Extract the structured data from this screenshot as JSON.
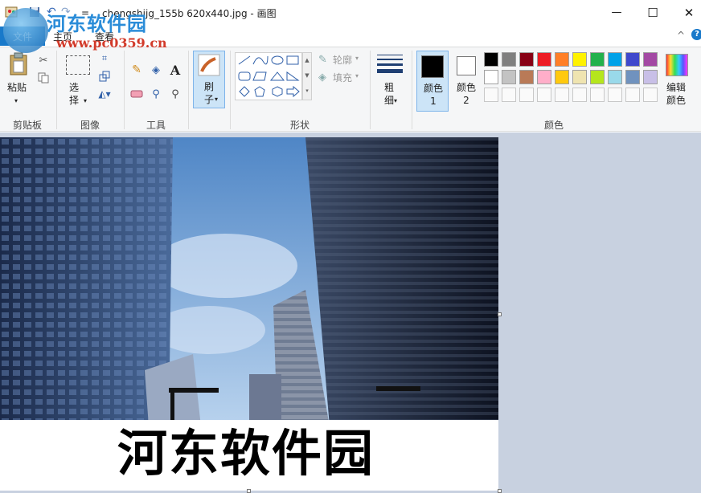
{
  "titlebar": {
    "filename": "chengshijg_155b 620x440.jpg",
    "separator": "-",
    "app_name": "画图",
    "qat_dropdown": "=",
    "minimize": "—",
    "maximize": "☐",
    "close": "✕"
  },
  "menu": {
    "file_tab": "文件",
    "home_tab": "主页",
    "view_tab": "查看",
    "help": "?",
    "collapse": "^"
  },
  "watermark": {
    "site_name": "河东软件园",
    "url": "www.pc0359.cn"
  },
  "ribbon": {
    "clipboard": {
      "paste_label": "粘贴",
      "group_label": "剪贴板"
    },
    "image": {
      "select_label": "选择",
      "group_label": "图像"
    },
    "tools": {
      "group_label": "工具"
    },
    "brushes": {
      "label": "刷子"
    },
    "shapes": {
      "outline_label": "轮廓",
      "fill_label": "填充",
      "group_label": "形状"
    },
    "size": {
      "label": "粗细"
    },
    "colors": {
      "color1_label": "颜色 1",
      "color2_label": "颜色 2",
      "edit_colors_label": "编辑颜色",
      "group_label": "颜色",
      "color1_value": "#000000",
      "color2_value": "#ffffff",
      "palette_row1": [
        "#000000",
        "#7f7f7f",
        "#880015",
        "#ed1c24",
        "#ff7f27",
        "#fff200",
        "#22b14c",
        "#00a2e8",
        "#3f48cc",
        "#a349a4"
      ],
      "palette_row2": [
        "#ffffff",
        "#c3c3c3",
        "#b97a57",
        "#ffaec9",
        "#ffc90e",
        "#efe4b0",
        "#b5e61d",
        "#99d9ea",
        "#7092be",
        "#c8bfe7"
      ]
    }
  },
  "canvas": {
    "caption": "河东软件园",
    "sky_color": "#7aa7d8",
    "building_color": "#1c2638"
  }
}
